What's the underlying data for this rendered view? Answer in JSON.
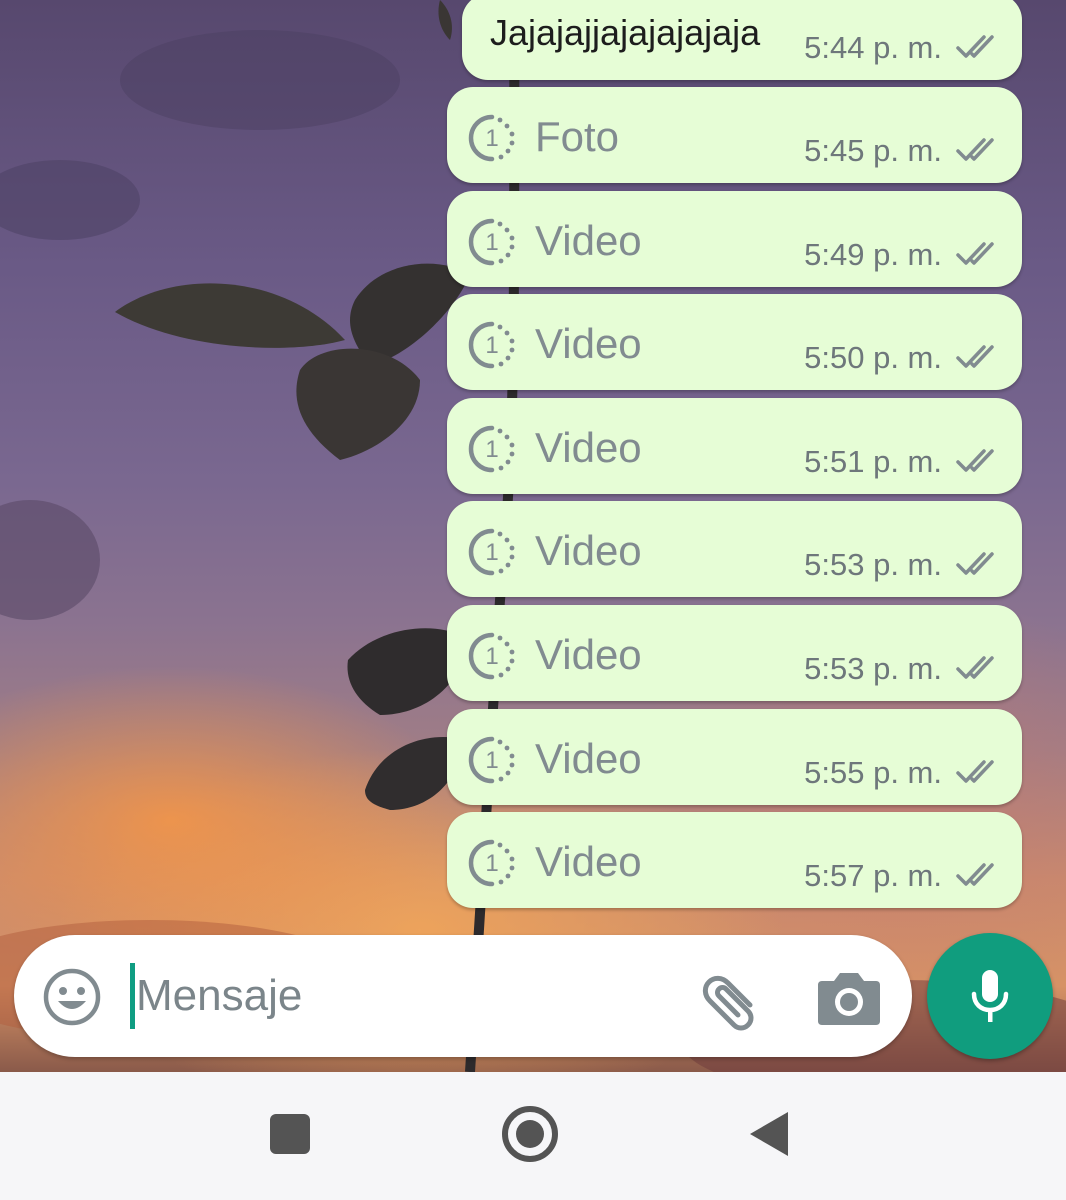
{
  "messages": [
    {
      "type": "text",
      "text": "Jajajajjajajajajaja",
      "time": "5:44 p. m.",
      "status_icon": "double-check-icon"
    },
    {
      "type": "view-once",
      "label": "Foto",
      "time": "5:45 p. m.",
      "status_icon": "double-check-icon"
    },
    {
      "type": "view-once",
      "label": "Video",
      "time": "5:49 p. m.",
      "status_icon": "double-check-icon"
    },
    {
      "type": "view-once",
      "label": "Video",
      "time": "5:50 p. m.",
      "status_icon": "double-check-icon"
    },
    {
      "type": "view-once",
      "label": "Video",
      "time": "5:51 p. m.",
      "status_icon": "double-check-icon"
    },
    {
      "type": "view-once",
      "label": "Video",
      "time": "5:53 p. m.",
      "status_icon": "double-check-icon"
    },
    {
      "type": "view-once",
      "label": "Video",
      "time": "5:53 p. m.",
      "status_icon": "double-check-icon"
    },
    {
      "type": "view-once",
      "label": "Video",
      "time": "5:55 p. m.",
      "status_icon": "double-check-icon"
    },
    {
      "type": "view-once",
      "label": "Video",
      "time": "5:57 p. m.",
      "status_icon": "double-check-icon"
    }
  ],
  "composer": {
    "placeholder": "Mensaje",
    "value": "",
    "icons": [
      "emoji-icon",
      "paperclip-icon",
      "camera-icon",
      "microphone-icon"
    ]
  },
  "navigation": {
    "buttons": [
      "recents",
      "home",
      "back"
    ]
  },
  "colors": {
    "bubble": "#e6fdd6",
    "accent": "#109d7e",
    "muted_text": "#818b90"
  }
}
